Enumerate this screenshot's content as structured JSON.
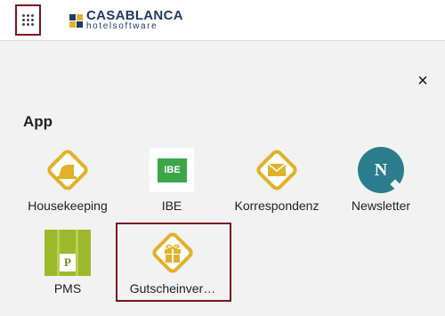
{
  "header": {
    "menu_icon": "grid-icon",
    "logo": {
      "name": "CASABLANCA",
      "sub": "hotelsoftware"
    }
  },
  "panel": {
    "close_icon": "close-icon",
    "close_glyph": "×",
    "section_title": "App"
  },
  "apps": [
    {
      "label": "Housekeeping",
      "icon": "iron-icon"
    },
    {
      "label": "IBE",
      "icon": "ibe-icon",
      "badge": "IBE"
    },
    {
      "label": "Korrespondenz",
      "icon": "envelope-icon"
    },
    {
      "label": "Newsletter",
      "icon": "newsletter-icon",
      "badge": "N"
    },
    {
      "label": "PMS",
      "icon": "pms-icon",
      "badge": "P"
    },
    {
      "label": "Gutscheinver…",
      "icon": "gift-icon"
    }
  ],
  "colors": {
    "accent": "#e0b12b",
    "highlight": "#7a1420",
    "logo_text": "#1f3a64",
    "ibe_green": "#3aa648",
    "newsletter_teal": "#2b7d8e",
    "pms_green": "#9cb92c"
  }
}
